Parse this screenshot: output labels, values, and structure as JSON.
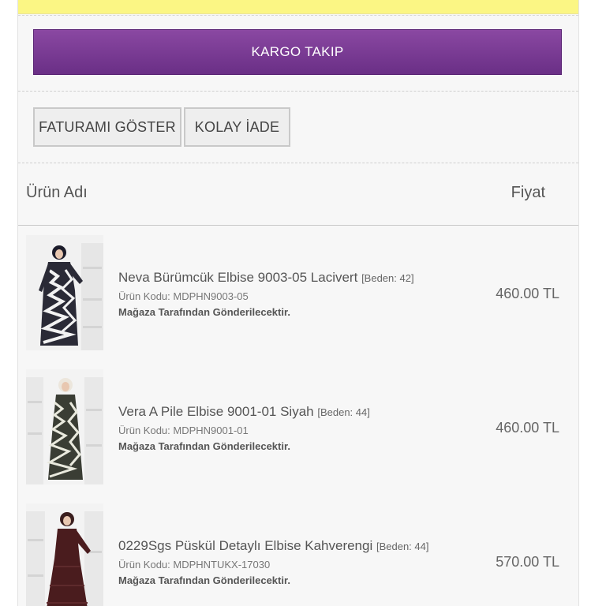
{
  "actions": {
    "kargo_label": "KARGO TAKIP",
    "invoice_label": "FATURAMI GÖSTER",
    "return_label": "KOLAY İADE"
  },
  "table": {
    "col_name": "Ürün Adı",
    "col_price": "Fiyat"
  },
  "products": [
    {
      "name": "Neva Bürümcük Elbise 9003-05 Lacivert",
      "size": "[Beden: 42]",
      "code": "Ürün Kodu: MDPHN9003-05",
      "note": "Mağaza Tarafından Gönderilecektir.",
      "price": "460.00 TL"
    },
    {
      "name": "Vera A Pile Elbise 9001-01 Siyah",
      "size": "[Beden: 44]",
      "code": "Ürün Kodu: MDPHN9001-01",
      "note": "Mağaza Tarafından Gönderilecektir.",
      "price": "460.00 TL"
    },
    {
      "name": "0229Sgs Püskül Detaylı Elbise Kahverengi",
      "size": "[Beden: 44]",
      "code": "Ürün Kodu: MDPHNTUKX-17030",
      "note": "Mağaza Tarafından Gönderilecektir.",
      "price": "570.00 TL"
    }
  ],
  "colors": {
    "accent_purple": "#7a3c95",
    "notice_yellow": "#fbf684",
    "panel_bg": "#f7f7f7"
  }
}
